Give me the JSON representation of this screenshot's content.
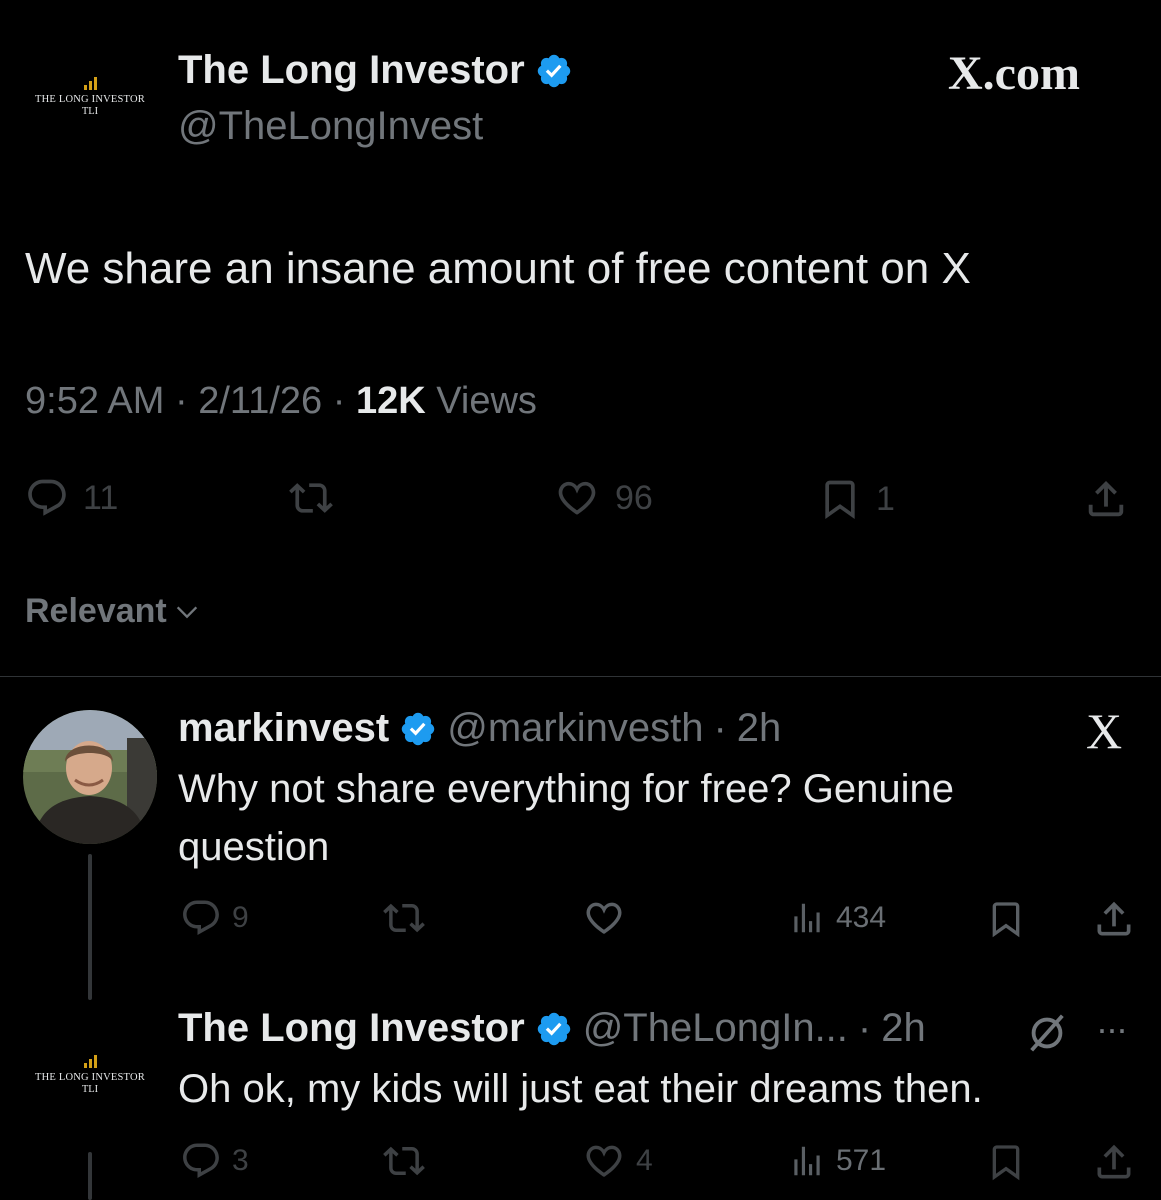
{
  "main_post": {
    "logo": {
      "name": "THE LONG INVESTOR",
      "abbr": "TLI"
    },
    "author_name": "The Long Investor",
    "author_handle": "@TheLongInvest",
    "brand": "X.com",
    "text": "We share an insane amount of free content on X",
    "time": "9:52 AM",
    "date": "2/11/26",
    "views_count": "12K",
    "views_label": "Views",
    "replies": "11",
    "likes": "96",
    "bookmarks": "1"
  },
  "sort": {
    "label": "Relevant"
  },
  "replies": [
    {
      "author_name": "markinvest",
      "author_handle": "@markinvesth",
      "age": "2h",
      "text": "Why not share everything for free?  Genuine question",
      "replies": "9",
      "views": "434"
    },
    {
      "logo": {
        "name": "THE LONG INVESTOR",
        "abbr": "TLI"
      },
      "author_name": "The Long Investor",
      "author_handle": "@TheLongIn...",
      "age": "2h",
      "text": "Oh ok, my kids will just eat their dreams then.",
      "replies": "3",
      "likes": "4",
      "views": "571"
    }
  ],
  "colors": {
    "accent_verified": "#1d9bf0",
    "logo_gold": "#d4a017",
    "muted": "#71767b"
  }
}
